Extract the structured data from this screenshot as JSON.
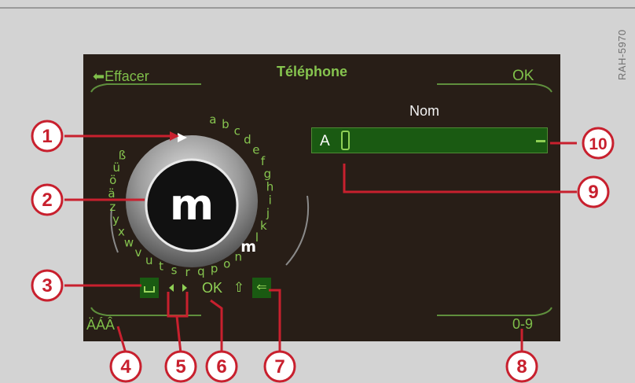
{
  "reference_code": "RAH-5970",
  "screen": {
    "title": "Téléphone",
    "left_top_softkey": "⬅Effacer",
    "right_top_softkey": "OK",
    "left_bottom_softkey": "ÄÁÂ",
    "right_bottom_softkey": "0-9",
    "field_label": "Nom",
    "field_value": "A"
  },
  "speller": {
    "selected_letter": "m",
    "letters": [
      "a",
      "b",
      "c",
      "d",
      "e",
      "f",
      "g",
      "h",
      "i",
      "j",
      "k",
      "l",
      "m",
      "n",
      "o",
      "p",
      "q",
      "r",
      "s",
      "t",
      "u",
      "v",
      "w",
      "x",
      "y",
      "z",
      "ä",
      "ö",
      "ü",
      "ß"
    ]
  },
  "bottom_keys": {
    "space_icon": "space-bar-icon",
    "left_icon": "arrow-left-icon",
    "right_icon": "arrow-right-icon",
    "ok_label": "OK",
    "shift_label": "⇧",
    "backspace_label": "⇐"
  },
  "callouts": [
    "1",
    "2",
    "3",
    "4",
    "5",
    "6",
    "7",
    "8",
    "9",
    "10"
  ],
  "colors": {
    "screen_bg": "#281e17",
    "accent_green": "#86c44f",
    "field_green": "#1a5a12",
    "callout_red": "#c8202e"
  }
}
